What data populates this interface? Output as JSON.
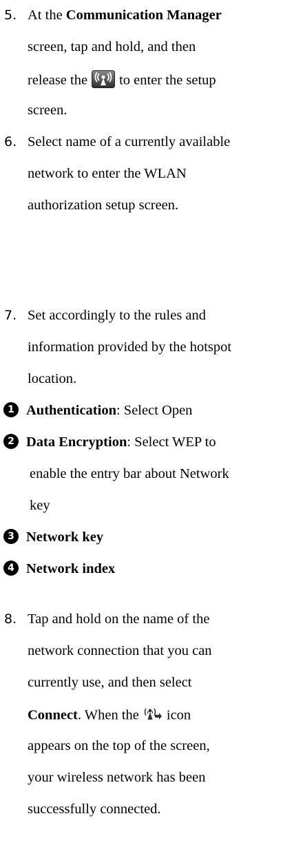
{
  "icons": {
    "wireless": "wireless-antenna-icon",
    "connected": "network-connected-icon"
  },
  "step5": {
    "number": "5.",
    "prefix": "At the ",
    "strong": "Communication Manager",
    "line2": "screen, tap and hold, and then",
    "line3_before": "release the",
    "line3_after": "to enter the setup",
    "line4": "screen."
  },
  "step6": {
    "number": "6.",
    "line1": "Select name of a currently available",
    "line2": "network to enter the WLAN",
    "line3": "authorization setup screen."
  },
  "step7": {
    "number": "7.",
    "line1": "Set accordingly to the rules and",
    "line2": "information provided by the hotspot",
    "line3": "location."
  },
  "settings": [
    {
      "marker": "1",
      "label": "Authentication",
      "text": ": Select Open"
    },
    {
      "marker": "2",
      "label": "Data Encryption",
      "text": ": Select WEP to",
      "line2": "enable the entry bar about Network",
      "line3": "key"
    },
    {
      "marker": "3",
      "label": "Network key"
    },
    {
      "marker": "4",
      "label": "Network index"
    }
  ],
  "step8": {
    "number": "8.",
    "line1": "Tap and hold on the name of the",
    "line2": "network connection that you can",
    "line3": "currently use, and then select",
    "line4_strong": "Connect",
    "line4_before": ". When the",
    "line4_after": "icon",
    "line5": "appears on the top of the screen,",
    "line6": "your wireless network has been",
    "line7": "successfully connected."
  }
}
